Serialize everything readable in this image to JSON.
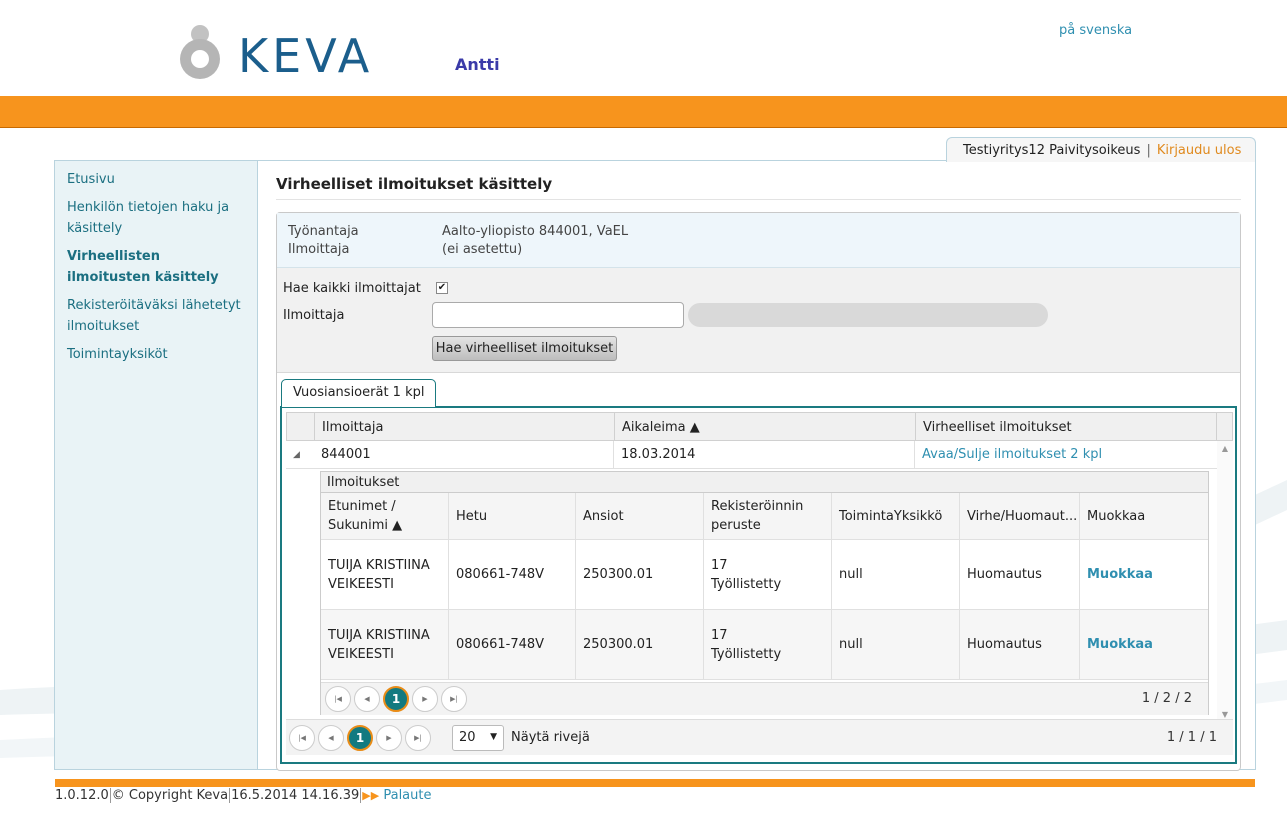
{
  "header": {
    "brand": "KEVA",
    "app_name": "Antti",
    "language_link": "på svenska"
  },
  "user_bar": {
    "organization": "Testiyritys12 Paivitysoikeus",
    "separator": "|",
    "logout": "Kirjaudu ulos"
  },
  "sidebar": {
    "items": [
      {
        "label": "Etusivu",
        "active": false
      },
      {
        "label": "Henkilön tietojen haku ja käsittely",
        "active": false
      },
      {
        "label": "Virheellisten ilmoitusten käsittely",
        "active": true
      },
      {
        "label": "Rekisteröitäväksi lähetetyt ilmoitukset",
        "active": false
      },
      {
        "label": "Toimintayksiköt",
        "active": false
      }
    ]
  },
  "page": {
    "title": "Virheelliset ilmoitukset käsittely",
    "info": {
      "employer_label": "Työnantaja",
      "employer_value": "Aalto-yliopisto 844001, VaEL",
      "reporter_label": "Ilmoittaja",
      "reporter_value": "(ei asetettu)"
    },
    "filter": {
      "all_reporters_label": "Hae kaikki ilmoittajat",
      "all_reporters_checked": true,
      "checkmark": "✔",
      "reporter_label": "Ilmoittaja",
      "reporter_value": "",
      "search_button": "Hae virheelliset ilmoitukset"
    },
    "tab_label": "Vuosiansioerät 1 kpl",
    "grid": {
      "columns": [
        "Ilmoittaja",
        "Aikaleima ▲",
        "Virheelliset ilmoitukset"
      ],
      "row": {
        "reporter": "844001",
        "timestamp": "18.03.2014",
        "link": "Avaa/Sulje ilmoitukset 2 kpl"
      },
      "nested": {
        "caption": "Ilmoitukset",
        "columns": [
          "Etunimet / Sukunimi ▲",
          "Hetu",
          "Ansiot",
          "Rekisteröinnin peruste",
          "ToimintaYksikkö",
          "Virhe/Huomaut...",
          "Muokkaa"
        ],
        "rows": [
          {
            "name": "TUIJA KRISTIINA VEIKEESTI",
            "hetu": "080661-748V",
            "ansiot": "250300.01",
            "peruste_code": "17",
            "peruste_text": "Työllistetty",
            "unit": "null",
            "error": "Huomautus",
            "edit": "Muokkaa"
          },
          {
            "name": "TUIJA KRISTIINA VEIKEESTI",
            "hetu": "080661-748V",
            "ansiot": "250300.01",
            "peruste_code": "17",
            "peruste_text": "Työllistetty",
            "unit": "null",
            "error": "Huomautus",
            "edit": "Muokkaa"
          }
        ],
        "pager": {
          "current_page": "1",
          "info": "1 / 2 / 2"
        }
      },
      "pager": {
        "current_page": "1",
        "page_size": "20",
        "rows_label": "Näytä rivejä",
        "info": "1 / 1 / 1"
      }
    }
  },
  "footer": {
    "version": "1.0.12.0",
    "copyright": "© Copyright Keva",
    "timestamp": "16.5.2014 14.16.39",
    "feedback": "Palaute"
  },
  "colors": {
    "brand_blue": "#1b5e8c",
    "orange": "#f7941d",
    "teal": "#1a7a80",
    "link": "#2f8fb0"
  }
}
